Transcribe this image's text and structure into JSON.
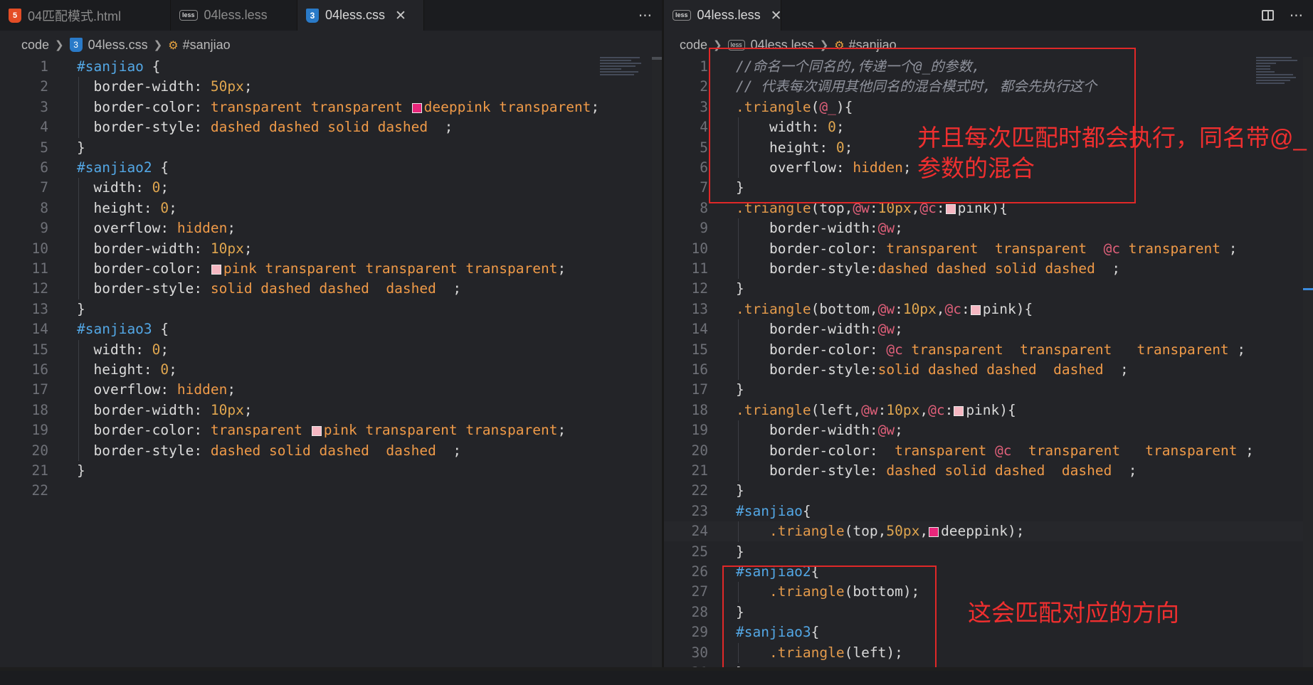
{
  "left_pane": {
    "tabs": [
      {
        "label": "04匹配模式.html",
        "icon": "html5-icon",
        "active": false
      },
      {
        "label": "04less.less",
        "icon": "less-icon",
        "active": false
      },
      {
        "label": "04less.css",
        "icon": "css3-icon",
        "active": true,
        "close": "✕"
      }
    ],
    "more_actions": "···",
    "breadcrumb": {
      "folder": "code",
      "file": "04less.css",
      "symbol": "#sanjiao"
    },
    "lines": [
      [
        [
          "#sanjiao",
          "sel"
        ],
        [
          " {",
          "punct"
        ]
      ],
      [
        [
          "  border-width",
          "prop"
        ],
        [
          ": ",
          "punct"
        ],
        [
          "50px",
          "num"
        ],
        [
          ";",
          "punct"
        ]
      ],
      [
        [
          "  border-color",
          "prop"
        ],
        [
          ": ",
          "punct"
        ],
        [
          "transparent transparent ",
          "kw"
        ],
        [
          "@sw:#e8267b",
          ""
        ],
        [
          "deeppink",
          "kw"
        ],
        [
          " transparent",
          "kw"
        ],
        [
          ";",
          "punct"
        ]
      ],
      [
        [
          "  border-style",
          "prop"
        ],
        [
          ": ",
          "punct"
        ],
        [
          "dashed dashed solid dashed",
          "kw"
        ],
        [
          "  ;",
          "punct"
        ]
      ],
      [
        [
          "}",
          "punct"
        ]
      ],
      [
        [
          "#sanjiao2",
          "sel"
        ],
        [
          " {",
          "punct"
        ]
      ],
      [
        [
          "  width",
          "prop"
        ],
        [
          ": ",
          "punct"
        ],
        [
          "0",
          "num"
        ],
        [
          ";",
          "punct"
        ]
      ],
      [
        [
          "  height",
          "prop"
        ],
        [
          ": ",
          "punct"
        ],
        [
          "0",
          "num"
        ],
        [
          ";",
          "punct"
        ]
      ],
      [
        [
          "  overflow",
          "prop"
        ],
        [
          ": ",
          "punct"
        ],
        [
          "hidden",
          "kw"
        ],
        [
          ";",
          "punct"
        ]
      ],
      [
        [
          "  border-width",
          "prop"
        ],
        [
          ": ",
          "punct"
        ],
        [
          "10px",
          "num"
        ],
        [
          ";",
          "punct"
        ]
      ],
      [
        [
          "  border-color",
          "prop"
        ],
        [
          ": ",
          "punct"
        ],
        [
          "@sw:#f5b7c2",
          ""
        ],
        [
          "pink transparent transparent transparent",
          "kw"
        ],
        [
          ";",
          "punct"
        ]
      ],
      [
        [
          "  border-style",
          "prop"
        ],
        [
          ": ",
          "punct"
        ],
        [
          "solid dashed dashed  dashed",
          "kw"
        ],
        [
          "  ;",
          "punct"
        ]
      ],
      [
        [
          "}",
          "punct"
        ]
      ],
      [
        [
          "#sanjiao3",
          "sel"
        ],
        [
          " {",
          "punct"
        ]
      ],
      [
        [
          "  width",
          "prop"
        ],
        [
          ": ",
          "punct"
        ],
        [
          "0",
          "num"
        ],
        [
          ";",
          "punct"
        ]
      ],
      [
        [
          "  height",
          "prop"
        ],
        [
          ": ",
          "punct"
        ],
        [
          "0",
          "num"
        ],
        [
          ";",
          "punct"
        ]
      ],
      [
        [
          "  overflow",
          "prop"
        ],
        [
          ": ",
          "punct"
        ],
        [
          "hidden",
          "kw"
        ],
        [
          ";",
          "punct"
        ]
      ],
      [
        [
          "  border-width",
          "prop"
        ],
        [
          ": ",
          "punct"
        ],
        [
          "10px",
          "num"
        ],
        [
          ";",
          "punct"
        ]
      ],
      [
        [
          "  border-color",
          "prop"
        ],
        [
          ": ",
          "punct"
        ],
        [
          "transparent ",
          "kw"
        ],
        [
          "@sw:#f5b7c2",
          ""
        ],
        [
          "pink transparent transparent",
          "kw"
        ],
        [
          ";",
          "punct"
        ]
      ],
      [
        [
          "  border-style",
          "prop"
        ],
        [
          ": ",
          "punct"
        ],
        [
          "dashed solid dashed  dashed",
          "kw"
        ],
        [
          "  ;",
          "punct"
        ]
      ],
      [
        [
          "}",
          "punct"
        ]
      ],
      []
    ]
  },
  "right_pane": {
    "tabs": [
      {
        "label": "04less.less",
        "icon": "less-icon",
        "active": true,
        "close": "✕"
      }
    ],
    "more_actions": "···",
    "breadcrumb": {
      "folder": "code",
      "file": "04less.less",
      "symbol": "#sanjiao"
    },
    "lines": [
      [
        [
          "//命名一个同名的,传递一个@_的参数,",
          "cmt"
        ]
      ],
      [
        [
          "// 代表每次调用其他同名的混合模式时, 都会先执行这个",
          "cmt"
        ]
      ],
      [
        [
          ".triangle",
          "mix"
        ],
        [
          "(",
          "punct"
        ],
        [
          "@_",
          "var"
        ],
        [
          "){",
          "punct"
        ]
      ],
      [
        [
          "    width",
          "prop"
        ],
        [
          ": ",
          "punct"
        ],
        [
          "0",
          "num"
        ],
        [
          ";",
          "punct"
        ]
      ],
      [
        [
          "    height",
          "prop"
        ],
        [
          ": ",
          "punct"
        ],
        [
          "0",
          "num"
        ],
        [
          ";",
          "punct"
        ]
      ],
      [
        [
          "    overflow",
          "prop"
        ],
        [
          ": ",
          "punct"
        ],
        [
          "hidden",
          "kw"
        ],
        [
          ";",
          "punct"
        ]
      ],
      [
        [
          "}",
          "punct"
        ]
      ],
      [
        [
          ".triangle",
          "mix"
        ],
        [
          "(top,",
          "punct"
        ],
        [
          "@w",
          "var"
        ],
        [
          ":",
          "punct"
        ],
        [
          "10px",
          "num"
        ],
        [
          ",",
          "punct"
        ],
        [
          "@c",
          "var"
        ],
        [
          ":",
          "punct"
        ],
        [
          "@sw:#f5b7c2",
          ""
        ],
        [
          "pink",
          "punct"
        ],
        [
          "){",
          "punct"
        ]
      ],
      [
        [
          "    border-width",
          "prop"
        ],
        [
          ":",
          "punct"
        ],
        [
          "@w",
          "var"
        ],
        [
          ";",
          "punct"
        ]
      ],
      [
        [
          "    border-color",
          "prop"
        ],
        [
          ": ",
          "punct"
        ],
        [
          "transparent  transparent  ",
          "kw"
        ],
        [
          "@c",
          "var"
        ],
        [
          " transparent",
          "kw"
        ],
        [
          " ;",
          "punct"
        ]
      ],
      [
        [
          "    border-style",
          "prop"
        ],
        [
          ":",
          "punct"
        ],
        [
          "dashed dashed solid dashed",
          "kw"
        ],
        [
          "  ;",
          "punct"
        ]
      ],
      [
        [
          "}",
          "punct"
        ]
      ],
      [
        [
          ".triangle",
          "mix"
        ],
        [
          "(bottom,",
          "punct"
        ],
        [
          "@w",
          "var"
        ],
        [
          ":",
          "punct"
        ],
        [
          "10px",
          "num"
        ],
        [
          ",",
          "punct"
        ],
        [
          "@c",
          "var"
        ],
        [
          ":",
          "punct"
        ],
        [
          "@sw:#f5b7c2",
          ""
        ],
        [
          "pink",
          "punct"
        ],
        [
          "){",
          "punct"
        ]
      ],
      [
        [
          "    border-width",
          "prop"
        ],
        [
          ":",
          "punct"
        ],
        [
          "@w",
          "var"
        ],
        [
          ";",
          "punct"
        ]
      ],
      [
        [
          "    border-color",
          "prop"
        ],
        [
          ": ",
          "punct"
        ],
        [
          "@c",
          "var"
        ],
        [
          " transparent  transparent   transparent",
          "kw"
        ],
        [
          " ;",
          "punct"
        ]
      ],
      [
        [
          "    border-style",
          "prop"
        ],
        [
          ":",
          "punct"
        ],
        [
          "solid dashed dashed  dashed",
          "kw"
        ],
        [
          "  ;",
          "punct"
        ]
      ],
      [
        [
          "}",
          "punct"
        ]
      ],
      [
        [
          ".triangle",
          "mix"
        ],
        [
          "(left,",
          "punct"
        ],
        [
          "@w",
          "var"
        ],
        [
          ":",
          "punct"
        ],
        [
          "10px",
          "num"
        ],
        [
          ",",
          "punct"
        ],
        [
          "@c",
          "var"
        ],
        [
          ":",
          "punct"
        ],
        [
          "@sw:#f5b7c2",
          ""
        ],
        [
          "pink",
          "punct"
        ],
        [
          "){",
          "punct"
        ]
      ],
      [
        [
          "    border-width",
          "prop"
        ],
        [
          ":",
          "punct"
        ],
        [
          "@w",
          "var"
        ],
        [
          ";",
          "punct"
        ]
      ],
      [
        [
          "    border-color",
          "prop"
        ],
        [
          ":  ",
          "punct"
        ],
        [
          "transparent ",
          "kw"
        ],
        [
          "@c",
          "var"
        ],
        [
          "  transparent   transparent",
          "kw"
        ],
        [
          " ;",
          "punct"
        ]
      ],
      [
        [
          "    border-style",
          "prop"
        ],
        [
          ": ",
          "punct"
        ],
        [
          "dashed solid dashed  dashed",
          "kw"
        ],
        [
          "  ;",
          "punct"
        ]
      ],
      [
        [
          "}",
          "punct"
        ]
      ],
      [
        [
          "#sanjiao",
          "sel"
        ],
        [
          "{",
          "punct"
        ]
      ],
      [
        [
          "    ",
          "punct"
        ],
        [
          ".triangle",
          "mix"
        ],
        [
          "(top,",
          "punct"
        ],
        [
          "50px",
          "num"
        ],
        [
          ",",
          "punct"
        ],
        [
          "@sw:#e8267b",
          ""
        ],
        [
          "deeppink",
          "punct"
        ],
        [
          ");",
          "punct"
        ]
      ],
      [
        [
          "}",
          "punct"
        ]
      ],
      [
        [
          "#sanjiao2",
          "sel"
        ],
        [
          "{",
          "punct"
        ]
      ],
      [
        [
          "    ",
          "punct"
        ],
        [
          ".triangle",
          "mix"
        ],
        [
          "(bottom);",
          "punct"
        ]
      ],
      [
        [
          "}",
          "punct"
        ]
      ],
      [
        [
          "#sanjiao3",
          "sel"
        ],
        [
          "{",
          "punct"
        ]
      ],
      [
        [
          "    ",
          "punct"
        ],
        [
          ".triangle",
          "mix"
        ],
        [
          "(left);",
          "punct"
        ]
      ],
      [
        [
          "}",
          "punct"
        ]
      ]
    ],
    "annotations": {
      "note1_line1": "并且每次匹配时都会执行，同名带@_",
      "note1_line2": "参数的混合",
      "note2": "这会匹配对应的方向"
    }
  },
  "colors": {
    "annotation_red": "#e02828",
    "selector": "#53a7e5",
    "value_keyword": "#ef9a48",
    "variable": "#e0607a",
    "comment": "#8f929c"
  }
}
